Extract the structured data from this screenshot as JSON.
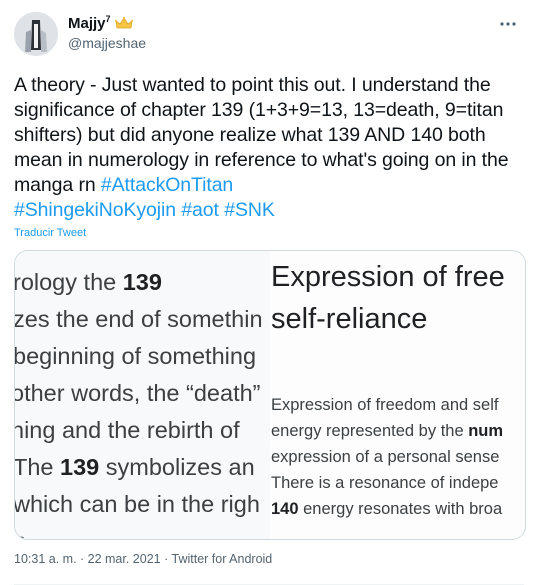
{
  "author": {
    "name": "Majjy",
    "superscript": "7",
    "handle": "@majjeshae",
    "badge_icon": "crown-icon"
  },
  "tweet": {
    "text_plain": "A theory - Just wanted to point this out. I understand the significance of chapter 139 (1+3+9=13, 13=death, 9=titan shifters) but did anyone realize what 139 AND 140 both mean in numerology in reference to what's going on in the manga rn ",
    "hashtags": [
      "#AttackOnTitan",
      "#ShingekiNoKyojin",
      "#aot",
      "#SNK"
    ],
    "translate_label": "Traducir Tweet"
  },
  "media": {
    "left_lines": [
      {
        "pre": "rology the ",
        "bold": "139",
        "post": ""
      },
      {
        "pre": "zes the end of somethin",
        "bold": "",
        "post": ""
      },
      {
        "pre": "beginning of something",
        "bold": "",
        "post": ""
      },
      {
        "pre": "other words, the “death”",
        "bold": "",
        "post": ""
      },
      {
        "pre": "hing and the rebirth of",
        "bold": "",
        "post": ""
      },
      {
        "pre": " The ",
        "bold": "139",
        "post": " symbolizes an"
      },
      {
        "pre": "which can be in the righ",
        "bold": "",
        "post": ""
      },
      {
        "pre": "n.",
        "bold": "",
        "post": ""
      }
    ],
    "right_heading": [
      "Expression of free",
      "self-reliance"
    ],
    "right_lines": [
      {
        "pre": "Expression of freedom and self",
        "bold": "",
        "post": ""
      },
      {
        "pre": "energy represented by the ",
        "bold": "num",
        "post": ""
      },
      {
        "pre": "expression of a personal sense",
        "bold": "",
        "post": ""
      },
      {
        "pre": "There is a resonance of indepe",
        "bold": "",
        "post": ""
      },
      {
        "pre": "",
        "bold": "140",
        "post": " energy resonates with broa"
      }
    ]
  },
  "meta": {
    "timestamp": "10:31 a. m. · 22 mar. 2021",
    "separator": " · ",
    "source": "Twitter for Android"
  },
  "colors": {
    "link": "#1d9bf0",
    "secondary_text": "#536471",
    "border": "#cfd9de"
  }
}
